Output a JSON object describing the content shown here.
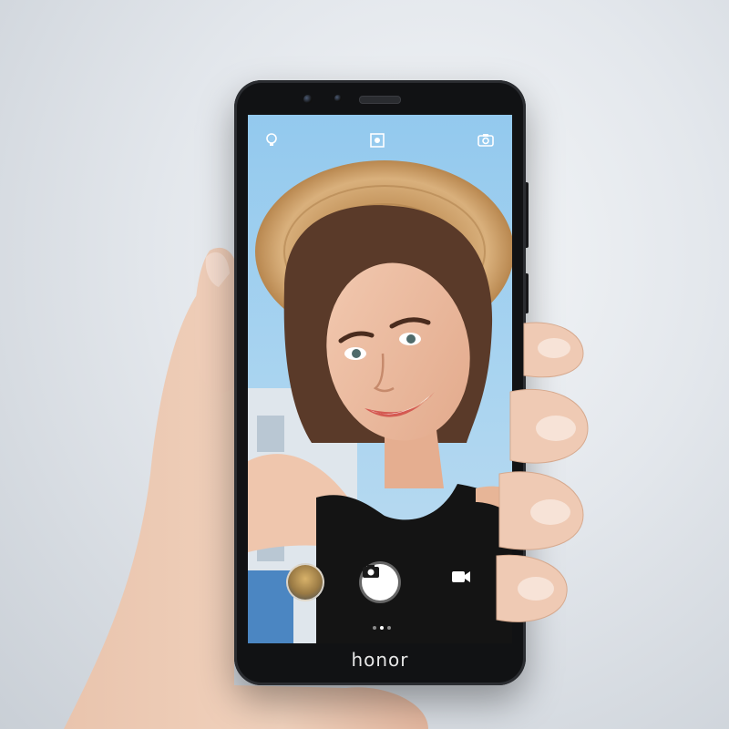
{
  "brand": {
    "logo_text": "honor"
  },
  "camera_ui": {
    "top_icons": [
      "flash-icon",
      "filter-icon",
      "switch-camera-icon"
    ],
    "bottom_controls": {
      "gallery_thumbnail": "gallery-thumbnail",
      "shutter_icon": "camera-icon",
      "video_icon": "video-camera-icon"
    },
    "mode_pages": 3,
    "active_mode_page": 2
  },
  "colors": {
    "background": "#dfe3e8",
    "phone_body": "#111214",
    "sky": "#8cc3ea",
    "shutter": "#ffffff"
  }
}
